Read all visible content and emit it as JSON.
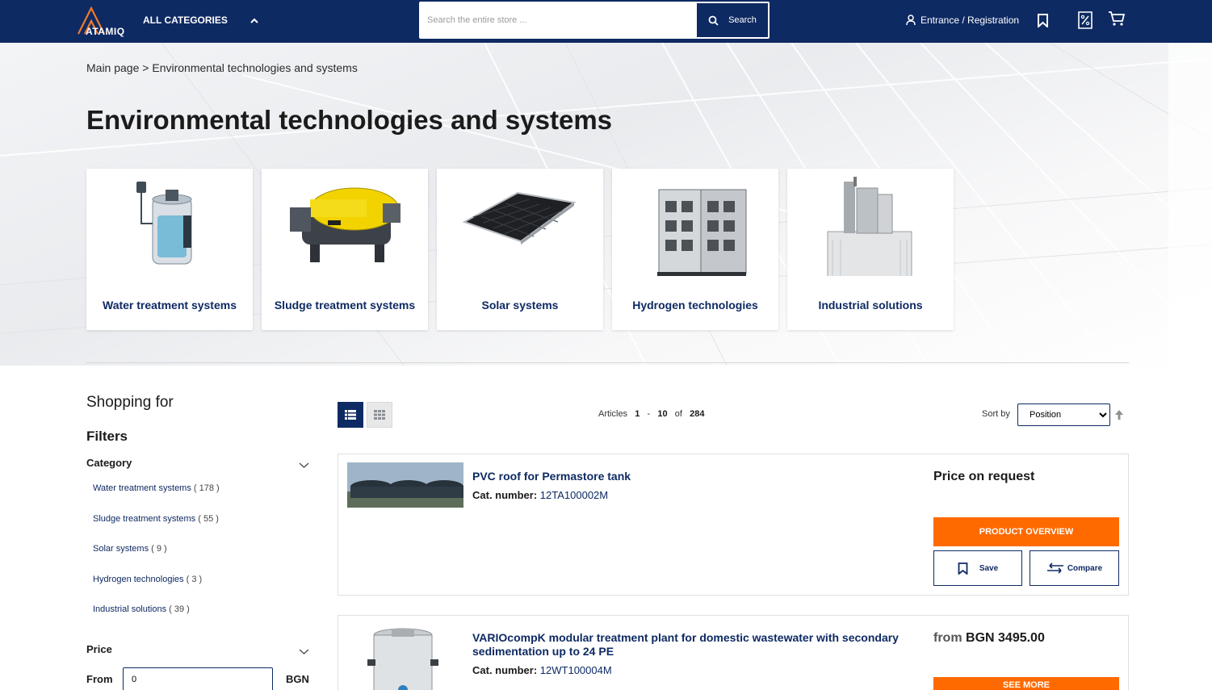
{
  "header": {
    "brand": "ATAMIQ",
    "all_categories": "ALL CATEGORIES",
    "search_placeholder": "Search the entire store ...",
    "search_button": "Search",
    "account_link": "Entrance / Registration"
  },
  "breadcrumb": {
    "home": "Main page",
    "separator": ">",
    "current": "Environmental technologies and systems"
  },
  "page_title": "Environmental technologies and systems",
  "categories": [
    {
      "label": "Water treatment systems"
    },
    {
      "label": "Sludge treatment systems"
    },
    {
      "label": "Solar systems"
    },
    {
      "label": "Hydrogen technologies"
    },
    {
      "label": "Industrial solutions"
    }
  ],
  "sidebar": {
    "shopping_for": "Shopping for",
    "filters": "Filters",
    "category_heading": "Category",
    "category_items": [
      {
        "label": "Water treatment systems",
        "count": "( 178 )"
      },
      {
        "label": "Sludge treatment systems",
        "count": "( 55 )"
      },
      {
        "label": "Solar systems",
        "count": "( 9 )"
      },
      {
        "label": "Hydrogen technologies",
        "count": "( 3 )"
      },
      {
        "label": "Industrial solutions",
        "count": "( 39 )"
      }
    ],
    "price_heading": "Price",
    "price_from_label": "From",
    "price_from_value": "0",
    "currency": "BGN"
  },
  "toolbar": {
    "articles_label": "Articles",
    "range_start": "1",
    "range_sep": "-",
    "range_end": "10",
    "of_label": "of",
    "total": "284",
    "sort_label": "Sort by",
    "sort_selected": "Position"
  },
  "products": [
    {
      "name": "PVC roof for Permastore tank",
      "catnum_label": "Cat. number:",
      "catnum": "12TA100002M",
      "price_prefix": "",
      "price": "Price on request",
      "overview_button": "PRODUCT OVERVIEW",
      "save_button": "Save",
      "compare_button": "Compare"
    },
    {
      "name": "VARIOcompK modular treatment plant for domestic wastewater with secondary sedimentation up to 24 PE",
      "catnum_label": "Cat. number:",
      "catnum": "12WT100004M",
      "price_prefix": "from",
      "price": "BGN 3495.00",
      "overview_button": "SEE MORE"
    }
  ],
  "colors": {
    "navy": "#0e2a63",
    "orange": "#ff6a00"
  }
}
